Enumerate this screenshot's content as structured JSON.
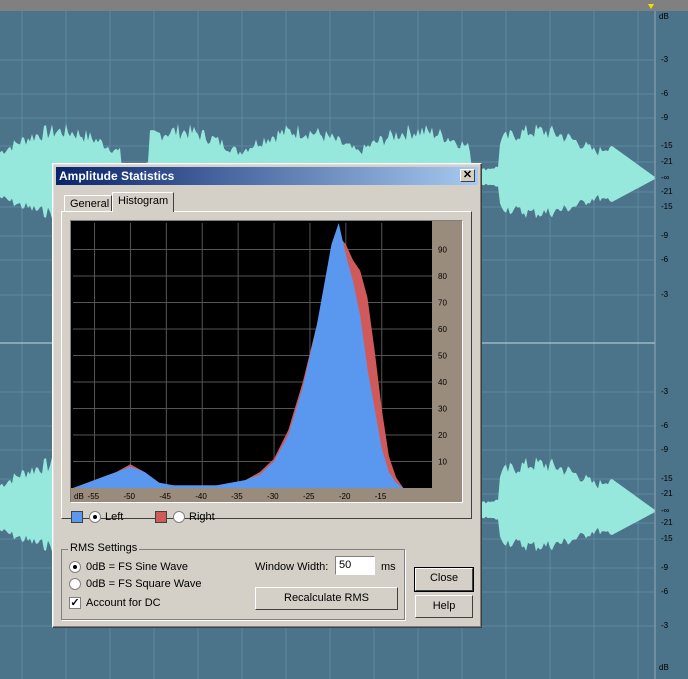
{
  "colors": {
    "wave": "#97e8dc",
    "left": "#5a98f0",
    "right": "#d05a5a",
    "grid": "#4a7a9a"
  },
  "editor": {
    "db_top": "dB",
    "db_bottom": "dB",
    "ruler_top": [
      "-3",
      "-6",
      "-9",
      "-15",
      "-21",
      "-∞",
      "-21",
      "-15",
      "-9",
      "-6",
      "-3"
    ],
    "ruler_bottom": [
      "-3",
      "-6",
      "-9",
      "-15",
      "-21",
      "-∞",
      "-21",
      "-15",
      "-9",
      "-6",
      "-3"
    ]
  },
  "dialog": {
    "title": "Amplitude Statistics",
    "close_glyph": "✕",
    "tabs": [
      {
        "label": "General"
      },
      {
        "label": "Histogram"
      }
    ],
    "legend": {
      "left_label": "Left",
      "right_label": "Right"
    },
    "rms": {
      "group_label": "RMS Settings",
      "sine_label": "0dB = FS Sine Wave",
      "square_label": "0dB = FS Square Wave",
      "dc_label": "Account for DC",
      "dc_mark": "✓",
      "window_label": "Window Width:",
      "window_value": "50",
      "window_unit": "ms",
      "recalc_label": "Recalculate RMS"
    },
    "close_label": "Close",
    "help_label": "Help"
  },
  "chart_data": {
    "type": "area",
    "xlabel": "dB",
    "x_ticks": [
      "-55",
      "-50",
      "-45",
      "-40",
      "-35",
      "-30",
      "-25",
      "-20",
      "-15"
    ],
    "y_ticks": [
      "10",
      "20",
      "30",
      "40",
      "50",
      "60",
      "70",
      "80",
      "90"
    ],
    "xlim": [
      -58,
      -8
    ],
    "ylim": [
      0,
      100
    ],
    "grid": true,
    "series": [
      {
        "name": "Left",
        "color": "#5a98f0",
        "x": [
          -58,
          -56,
          -54,
          -52,
          -50,
          -48,
          -46,
          -44,
          -42,
          -40,
          -38,
          -36,
          -34,
          -32,
          -30,
          -28,
          -26,
          -24,
          -22,
          -21,
          -20,
          -19,
          -18,
          -17,
          -16,
          -15,
          -14,
          -13,
          -12
        ],
        "y": [
          0,
          2,
          4,
          6,
          8,
          6,
          2,
          1,
          1,
          1,
          1,
          2,
          3,
          5,
          10,
          20,
          38,
          62,
          92,
          100,
          88,
          78,
          65,
          45,
          30,
          15,
          6,
          2,
          0
        ]
      },
      {
        "name": "Right",
        "color": "#d05a5a",
        "x": [
          -58,
          -56,
          -54,
          -52,
          -50,
          -48,
          -46,
          -44,
          -42,
          -40,
          -38,
          -36,
          -34,
          -32,
          -30,
          -28,
          -26,
          -24,
          -22,
          -21,
          -20,
          -19,
          -18,
          -17,
          -16,
          -15,
          -14,
          -13,
          -12
        ],
        "y": [
          0,
          2,
          4,
          6,
          9,
          6,
          2,
          1,
          1,
          1,
          1,
          2,
          3,
          6,
          11,
          22,
          40,
          62,
          88,
          95,
          92,
          86,
          82,
          72,
          52,
          30,
          12,
          4,
          0
        ]
      }
    ]
  }
}
